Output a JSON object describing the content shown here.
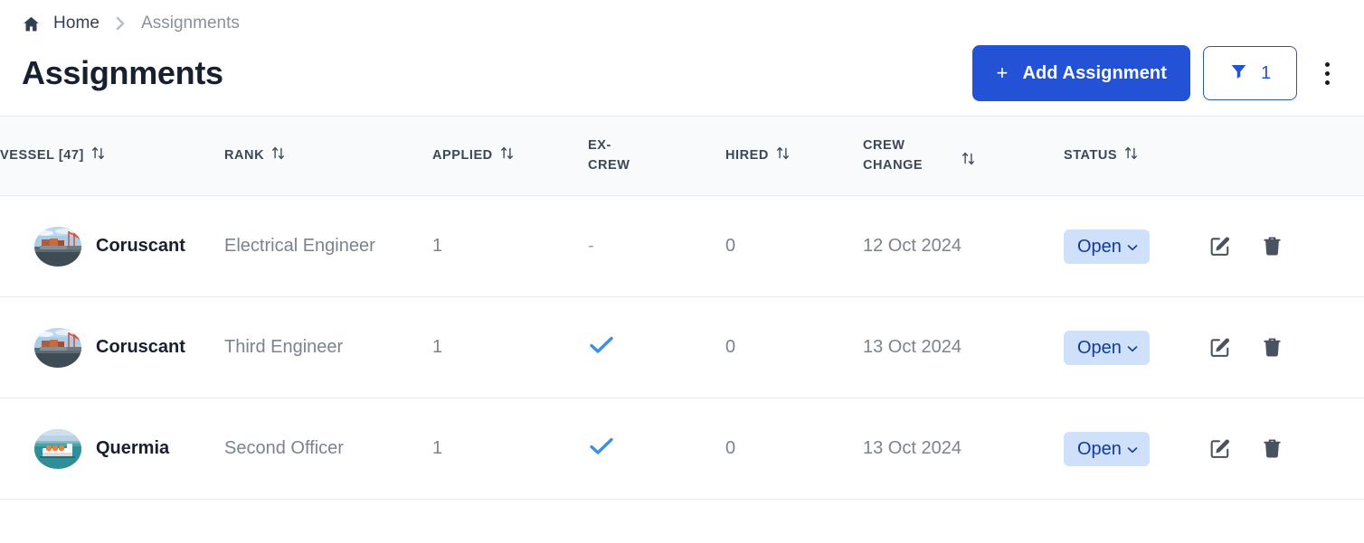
{
  "breadcrumb": {
    "home_label": "Home",
    "separator": "chevron-right",
    "current_label": "Assignments"
  },
  "header": {
    "title": "Assignments",
    "add_button_label": "Add Assignment",
    "add_button_plus": "+",
    "filter_count": "1",
    "kebab_label": "more-options"
  },
  "colors": {
    "primary": "#2352d6",
    "status_pill_bg": "#cfe0fb",
    "status_pill_text": "#123a9b",
    "check": "#3b8fe8",
    "header_bg": "#f8fafc",
    "border": "#e6e9ee"
  },
  "table": {
    "columns": [
      {
        "label": "VESSEL [47]",
        "sortable": true
      },
      {
        "label": "RANK",
        "sortable": true
      },
      {
        "label": "APPLIED",
        "sortable": true
      },
      {
        "label": "EX-\nCREW",
        "sortable": false
      },
      {
        "label": "HIRED",
        "sortable": true
      },
      {
        "label": "CREW\nCHANGE",
        "sortable": true
      },
      {
        "label": "STATUS",
        "sortable": true
      },
      {
        "label": "",
        "sortable": false
      }
    ],
    "column_labels": {
      "vessel": "VESSEL [47]",
      "rank": "RANK",
      "applied": "APPLIED",
      "excrew_line1": "EX-",
      "excrew_line2": "CREW",
      "hired": "HIRED",
      "crew_line1": "CREW",
      "crew_line2": "CHANGE",
      "status": "STATUS"
    },
    "rows": [
      {
        "vessel": "Coruscant",
        "vessel_thumb": "container-ship-cranes",
        "rank": "Electrical Engineer",
        "applied": "1",
        "ex_crew": "-",
        "ex_crew_type": "dash",
        "hired": "0",
        "crew_change": "12 Oct 2024",
        "status": "Open",
        "edit_label": "edit",
        "delete_label": "delete"
      },
      {
        "vessel": "Coruscant",
        "vessel_thumb": "container-ship-cranes",
        "rank": "Third Engineer",
        "applied": "1",
        "ex_crew": "✓",
        "ex_crew_type": "check",
        "hired": "0",
        "crew_change": "13 Oct 2024",
        "status": "Open",
        "edit_label": "edit",
        "delete_label": "delete"
      },
      {
        "vessel": "Quermia",
        "vessel_thumb": "lng-tanker",
        "rank": "Second Officer",
        "applied": "1",
        "ex_crew": "✓",
        "ex_crew_type": "check",
        "hired": "0",
        "crew_change": "13 Oct 2024",
        "status": "Open",
        "edit_label": "edit",
        "delete_label": "delete"
      }
    ]
  }
}
